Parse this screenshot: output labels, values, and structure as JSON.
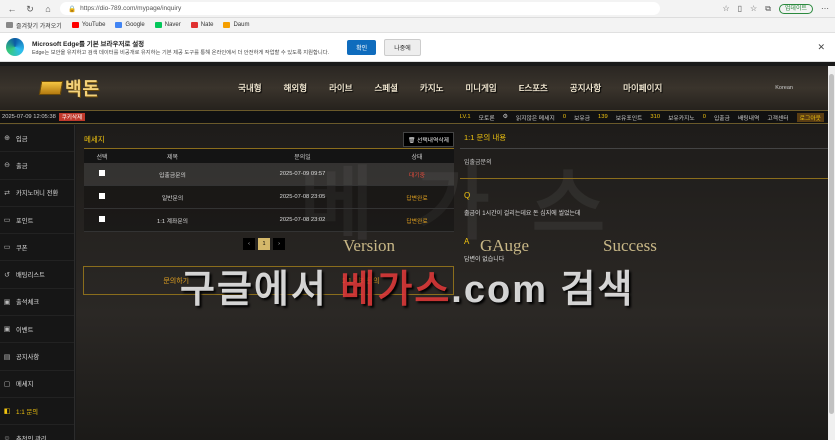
{
  "browser": {
    "url": "https://dio-789.com/mypage/inquiry",
    "update_label": "업데이트",
    "bookmarks": [
      {
        "label": "즐겨찾기 가져오기",
        "color": "#888888"
      },
      {
        "label": "YouTube",
        "color": "#ff0000"
      },
      {
        "label": "Google",
        "color": "#4285f4"
      },
      {
        "label": "Naver",
        "color": "#03c75a"
      },
      {
        "label": "Nate",
        "color": "#e03131"
      },
      {
        "label": "Daum",
        "color": "#f59f00"
      }
    ]
  },
  "edge_banner": {
    "title": "Microsoft Edge를 기본 브라우저로 설정",
    "desc": "Edge는 보안을 유지하고 검색 데이터를 비공개로 유지하는 기본 제공 도구를 통해 온라인에서 더 안전하게 작업할 수 있도록 지원합니다.",
    "ok_label": "확인",
    "later_label": "나중에"
  },
  "site": {
    "logo_text": "백돈",
    "nav": [
      "국내형",
      "해외형",
      "라이브",
      "스페셜",
      "카지노",
      "미니게임",
      "E스포츠",
      "공지사항",
      "마이페이지"
    ],
    "lang": "Korean"
  },
  "infobar": {
    "datetime": "2025-07-09 12:05:38",
    "badge": "쿠키삭제",
    "level": "LV.1",
    "username": "모토론",
    "items": [
      {
        "label": "읽지않은 메세지",
        "value": "0"
      },
      {
        "label": "보유금",
        "value": "139"
      },
      {
        "label": "보유포인트",
        "value": "310"
      },
      {
        "label": "보유카지노",
        "value": "0"
      }
    ],
    "links": [
      "입출금",
      "배팅내역",
      "고객센터"
    ],
    "logout": "로그아웃"
  },
  "sidebar": [
    {
      "icon": "login-icon",
      "glyph": "⊕",
      "label": "입금"
    },
    {
      "icon": "withdraw-icon",
      "glyph": "⊖",
      "label": "출금"
    },
    {
      "icon": "transfer-icon",
      "glyph": "⇄",
      "label": "카지노머니 전환"
    },
    {
      "icon": "point-icon",
      "glyph": "▭",
      "label": "포인트"
    },
    {
      "icon": "coupon-icon",
      "glyph": "▭",
      "label": "쿠폰"
    },
    {
      "icon": "history-icon",
      "glyph": "↺",
      "label": "배팅리스트"
    },
    {
      "icon": "attendance-icon",
      "glyph": "▣",
      "label": "출석체크"
    },
    {
      "icon": "event-icon",
      "glyph": "▣",
      "label": "이벤트"
    },
    {
      "icon": "notice-icon",
      "glyph": "▤",
      "label": "공지사항"
    },
    {
      "icon": "message-icon",
      "glyph": "▢",
      "label": "메세지"
    },
    {
      "icon": "inquiry-icon",
      "glyph": "◧",
      "label": "1:1 문의"
    },
    {
      "icon": "recommend-icon",
      "glyph": "☺",
      "label": "추천인 관리"
    }
  ],
  "messages": {
    "title": "메세지",
    "delete_label": "선택내역삭제",
    "headers": {
      "sel": "선택",
      "title": "제목",
      "date": "문의일",
      "state": "상태"
    },
    "rows": [
      {
        "title": "입출금문의",
        "date": "2025-07-09 09:57",
        "state": "대기중",
        "state_type": "wait"
      },
      {
        "title": "일반문의",
        "date": "2025-07-08 23:05",
        "state": "답변완료",
        "state_type": "done"
      },
      {
        "title": "1:1 계좌문의",
        "date": "2025-07-08 23:02",
        "state": "답변완료",
        "state_type": "done"
      }
    ],
    "pager": {
      "prev": "‹",
      "current": "1",
      "next": "›"
    },
    "inquiry_left": "문의하기",
    "inquiry_right": "1:1 계좌문의"
  },
  "detail": {
    "title": "1:1 문의 내용",
    "subject": "입출금문의",
    "q_mark": "Q",
    "question": "출금이 1시간이 걸리는데요 돈 심지에 씰었는데",
    "a_mark": "A",
    "answer": "답변이 없습니다"
  },
  "watermark": {
    "main_a": "구글에서 ",
    "main_b": "베가스",
    "main_c": ".com 검색",
    "ghost": "베 가 스",
    "version": "Version",
    "gauge": "GAuge",
    "success": "Success"
  }
}
